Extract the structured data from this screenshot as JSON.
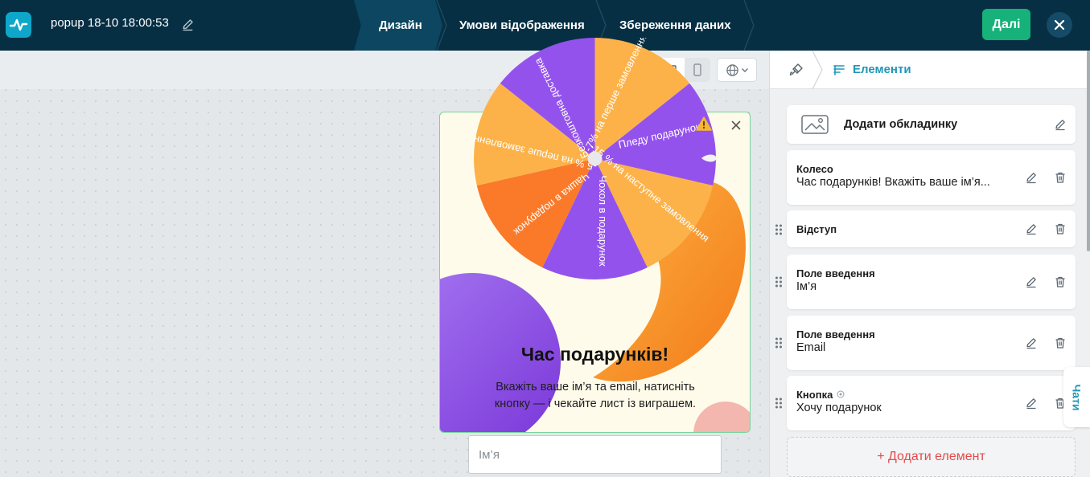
{
  "header": {
    "title": "popup 18-10 18:00:53",
    "steps": [
      "Дизайн",
      "Умови відображення",
      "Збереження даних"
    ],
    "next_label": "Далі"
  },
  "popup": {
    "wheel_segments": [
      "-7% на перше замовлення",
      "Пледу подарунок",
      "-15 % на наступне замовлення",
      "Чохол в подарунок",
      "Чашка в подарунок",
      "-5 % на перше замовлення",
      "Безкоштовна доставка"
    ],
    "heading": "Час подарунків!",
    "text_line1": "Вкажіть ваше ім’я та email, натисніть",
    "text_line2": "кнопку — і чекайте лист із виграшем.",
    "name_placeholder": "Ім’я"
  },
  "panel": {
    "title": "Елементи",
    "cover_label": "Додати обкладинку",
    "items": [
      {
        "label": "Колесо",
        "value": "Час подарунків! Вкажіть ваше ім’я..."
      },
      {
        "label": "Відступ",
        "value": ""
      },
      {
        "label": "Поле введення",
        "value": "Ім’я"
      },
      {
        "label": "Поле введення",
        "value": "Email"
      },
      {
        "label": "Кнопка",
        "value": "Хочу подарунок"
      }
    ],
    "add_label": "+ Додати елемент",
    "chat_label": "Чати"
  },
  "colors": {
    "topbar": "#062f44",
    "accent": "#1f97b8",
    "next": "#17b17a",
    "wheel_orange": "#fcb249",
    "wheel_purple": "#9452ed",
    "wheel_dark_orange": "#fa7a2a"
  }
}
